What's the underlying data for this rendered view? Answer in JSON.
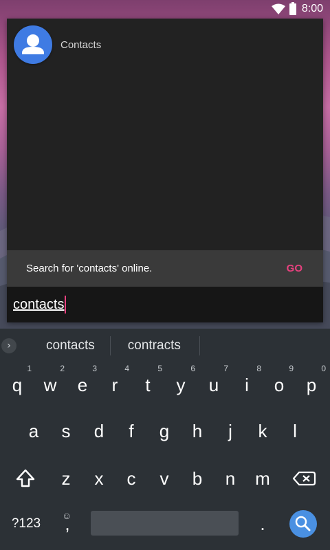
{
  "status_bar": {
    "time": "8:00"
  },
  "search_panel": {
    "app_result": {
      "label": "Contacts",
      "icon": "contacts-person-icon"
    },
    "web_suggestion": {
      "text": "Search for 'contacts' online.",
      "action": "GO"
    },
    "query": "contacts"
  },
  "keyboard": {
    "suggestions": [
      "contacts",
      "contracts"
    ],
    "row1": [
      {
        "key": "q",
        "hint": "1"
      },
      {
        "key": "w",
        "hint": "2"
      },
      {
        "key": "e",
        "hint": "3"
      },
      {
        "key": "r",
        "hint": "4"
      },
      {
        "key": "t",
        "hint": "5"
      },
      {
        "key": "y",
        "hint": "6"
      },
      {
        "key": "u",
        "hint": "7"
      },
      {
        "key": "i",
        "hint": "8"
      },
      {
        "key": "o",
        "hint": "9"
      },
      {
        "key": "p",
        "hint": "0"
      }
    ],
    "row2": [
      "a",
      "s",
      "d",
      "f",
      "g",
      "h",
      "j",
      "k",
      "l"
    ],
    "row3": [
      "z",
      "x",
      "c",
      "v",
      "b",
      "n",
      "m"
    ],
    "symbols_key": "?123",
    "comma_key": ",",
    "period_key": "."
  },
  "colors": {
    "accent": "#e8417f",
    "panel_bg": "#222222",
    "keyboard_bg": "#2c3136",
    "enter_key": "#4a90e2",
    "app_icon": "#3f7be3"
  }
}
